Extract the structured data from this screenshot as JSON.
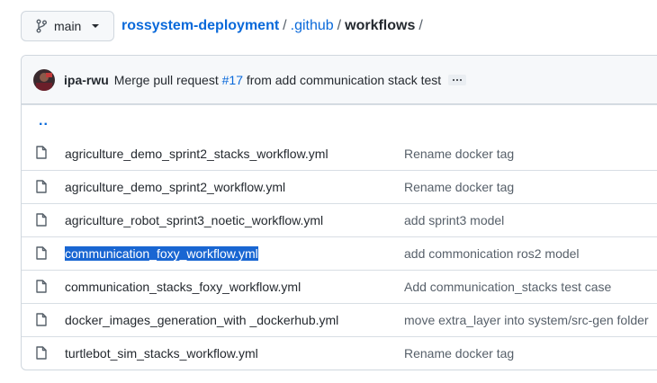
{
  "branch": {
    "label": "main",
    "icon": "git-branch-icon"
  },
  "breadcrumb": {
    "repo": "rossystem-deployment",
    "sep1": "/",
    "dir": ".github",
    "sep2": "/",
    "current": "workflows",
    "sep3": "/"
  },
  "commit": {
    "author": "ipa-rwu",
    "message_prefix": "Merge pull request",
    "pr": "#17",
    "message_suffix": "from add communication stack test",
    "more": "…"
  },
  "parent_dir": "..",
  "files": [
    {
      "name": "agriculture_demo_sprint2_stacks_workflow.yml",
      "message": "Rename docker tag",
      "selected": false
    },
    {
      "name": "agriculture_demo_sprint2_workflow.yml",
      "message": "Rename docker tag",
      "selected": false
    },
    {
      "name": "agriculture_robot_sprint3_noetic_workflow.yml",
      "message": "add sprint3 model",
      "selected": false
    },
    {
      "name": "communication_foxy_workflow.yml",
      "message": "add commonication ros2 model",
      "selected": true
    },
    {
      "name": "communication_stacks_foxy_workflow.yml",
      "message": "Add communication_stacks test case",
      "selected": false
    },
    {
      "name": "docker_images_generation_with _dockerhub.yml",
      "message": "move extra_layer into system/src-gen folder",
      "selected": false
    },
    {
      "name": "turtlebot_sim_stacks_workflow.yml",
      "message": "Rename docker tag",
      "selected": false
    }
  ],
  "colors": {
    "link": "#0969da",
    "selection": "#1966d2",
    "border": "#d0d7de",
    "muted": "#57606a"
  }
}
